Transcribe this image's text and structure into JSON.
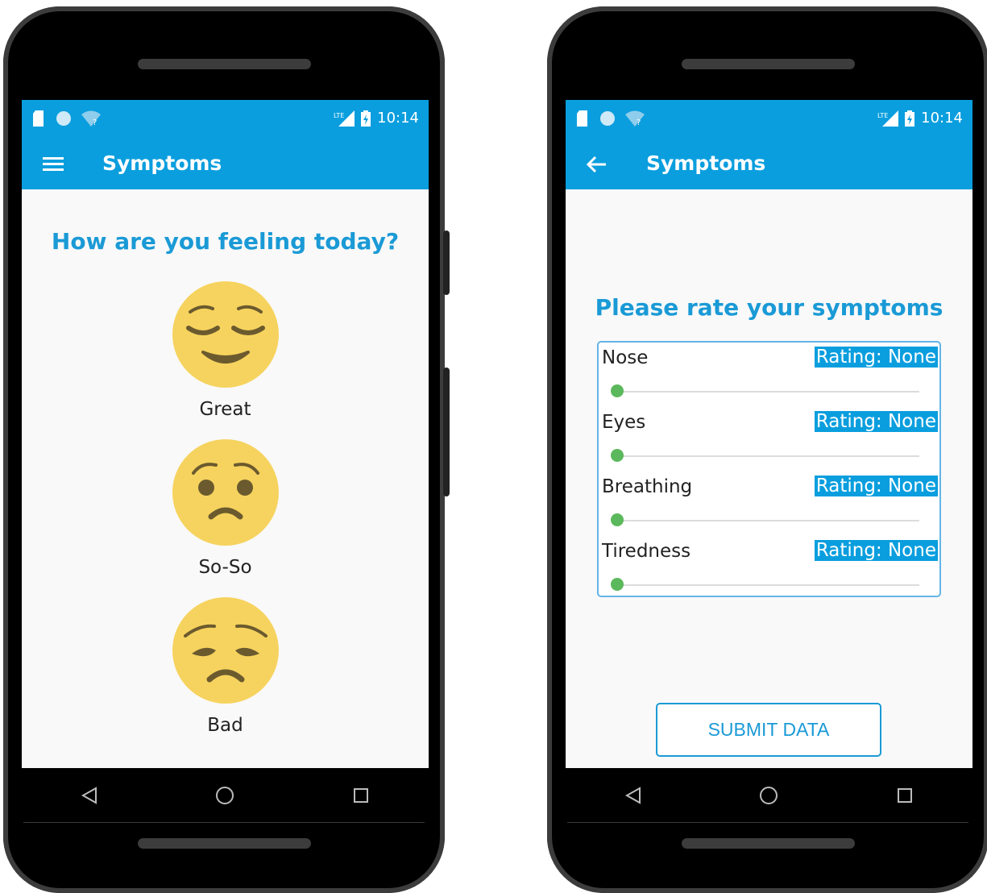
{
  "status_bar": {
    "time": "10:14",
    "network": "LTE"
  },
  "left_screen": {
    "app_title": "Symptoms",
    "question": "How are you feeling today?",
    "moods": [
      {
        "label": "Great",
        "icon": "relieved-face-icon"
      },
      {
        "label": "So-So",
        "icon": "worried-face-icon"
      },
      {
        "label": "Bad",
        "icon": "sad-face-icon"
      }
    ]
  },
  "right_screen": {
    "app_title": "Symptoms",
    "heading": "Please rate your symptoms",
    "symptoms": [
      {
        "name": "Nose",
        "rating": "Rating: None"
      },
      {
        "name": "Eyes",
        "rating": "Rating: None"
      },
      {
        "name": "Breathing",
        "rating": "Rating: None"
      },
      {
        "name": "Tiredness",
        "rating": "Rating: None"
      }
    ],
    "submit_label": "SUBMIT DATA"
  },
  "colors": {
    "primary": "#0a9ede",
    "accent_text": "#1a9ad6",
    "slider_thumb": "#5cb85c",
    "emoji": "#f6d35e"
  }
}
